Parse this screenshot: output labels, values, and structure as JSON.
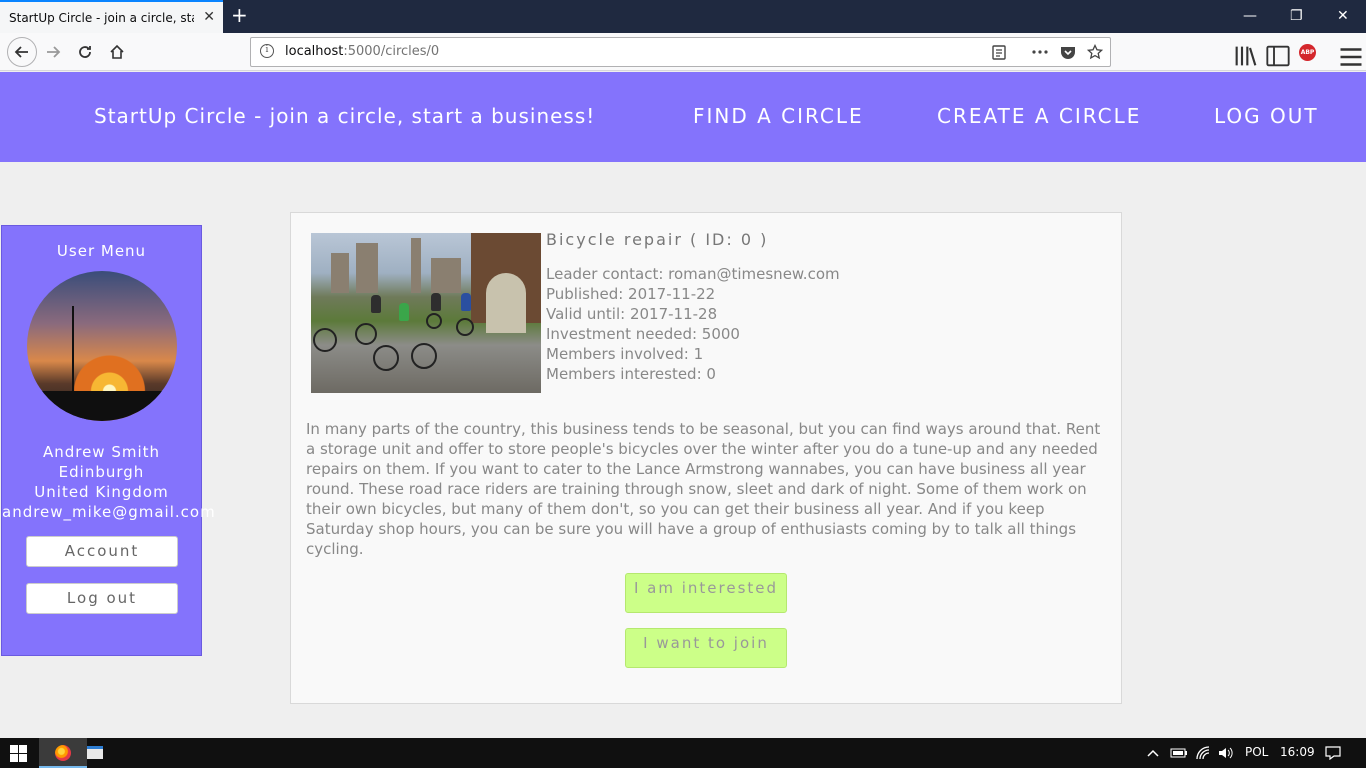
{
  "browser": {
    "tab_title": "StartUp Circle - join a circle, start a business!",
    "tab_close": "✕",
    "new_tab": "+",
    "url_host": "localhost",
    "url_path": ":5000/circles/0",
    "window_minimize": "—",
    "window_restore": "❐",
    "window_close": "✕",
    "abp_label": "ABP"
  },
  "site": {
    "brand": "StartUp Circle - join a circle, start a business!",
    "nav": [
      "FIND A CIRCLE",
      "CREATE A CIRCLE",
      "LOG OUT"
    ]
  },
  "sidebar": {
    "title": "User Menu",
    "user_name": "Andrew Smith",
    "city": "Edinburgh",
    "country": "United Kingdom",
    "email": "andrew_mike@gmail.com",
    "account_button": "Account",
    "logout_button": "Log out"
  },
  "circle": {
    "title": "Bicycle repair ( ID: 0 )",
    "leader": "Leader contact: roman@timesnew.com",
    "published": "Published: 2017-11-22",
    "valid_until": "Valid until: 2017-11-28",
    "investment": "Investment needed: 5000",
    "members_involved": "Members involved: 1",
    "members_interested": "Members interested: 0",
    "description": "In many parts of the country, this business tends to be seasonal, but you can find ways around that. Rent a storage unit and offer to store people's bicycles over the winter after you do a tune-up and any needed repairs on them. If you want to cater to the Lance Armstrong wannabes, you can have business all year round. These road race riders are training through snow, sleet and dark of night. Some of them work on their own bicycles, but many of them don't, so you can get their business all year. And if you keep Saturday shop hours, you can be sure you will have a group of enthusiasts coming by to talk all things cycling.",
    "interested_button": "I am interested",
    "join_button": "I want to join"
  },
  "taskbar": {
    "language": "POL",
    "time": "16:09"
  },
  "colors": {
    "header": "#8473fc",
    "action_button": "#ccff88"
  }
}
